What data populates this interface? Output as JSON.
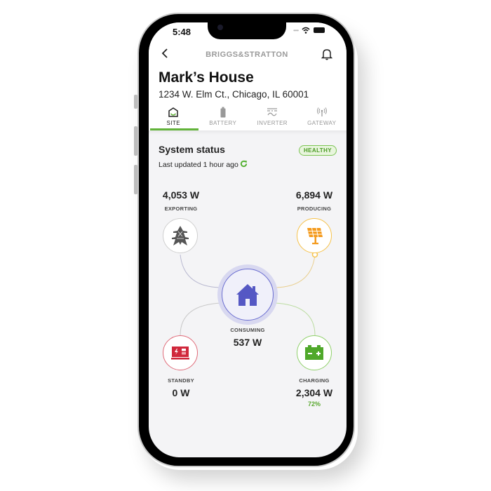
{
  "status_bar": {
    "time": "5:48"
  },
  "header": {
    "brand": "BRIGGS&STRATTON",
    "back_icon": "chevron-left-icon",
    "notification_icon": "bell-icon"
  },
  "site": {
    "name": "Mark’s House",
    "address": "1234 W. Elm Ct., Chicago, IL 60001"
  },
  "tabs": [
    {
      "label": "SITE",
      "icon": "house-icon",
      "active": true
    },
    {
      "label": "BATTERY",
      "icon": "battery-icon",
      "active": false
    },
    {
      "label": "INVERTER",
      "icon": "inverter-icon",
      "active": false
    },
    {
      "label": "GATEWAY",
      "icon": "antenna-icon",
      "active": false
    }
  ],
  "system_status": {
    "title": "System status",
    "badge": "HEALTHY",
    "last_updated": "Last updated 1 hour ago"
  },
  "nodes": {
    "grid": {
      "value": "4,053 W",
      "label": "EXPORTING",
      "icon": "power-tower-icon",
      "color": "#c8c8c8"
    },
    "solar": {
      "value": "6,894 W",
      "label": "PRODUCING",
      "icon": "solar-panel-icon",
      "color": "#f6a623"
    },
    "home": {
      "value": "537 W",
      "label": "CONSUMING",
      "icon": "house-icon",
      "color": "#5558c4"
    },
    "generator": {
      "value": "0 W",
      "label": "STANDBY",
      "icon": "generator-icon",
      "color": "#d0283c"
    },
    "battery": {
      "value": "2,304 W",
      "label": "CHARGING",
      "percent": "72%",
      "icon": "battery-icon",
      "color": "#62b33a"
    }
  },
  "colors": {
    "accent_green": "#62b33a",
    "home_purple": "#5558c4",
    "solar_orange": "#f6a623",
    "generator_red": "#d0283c"
  }
}
